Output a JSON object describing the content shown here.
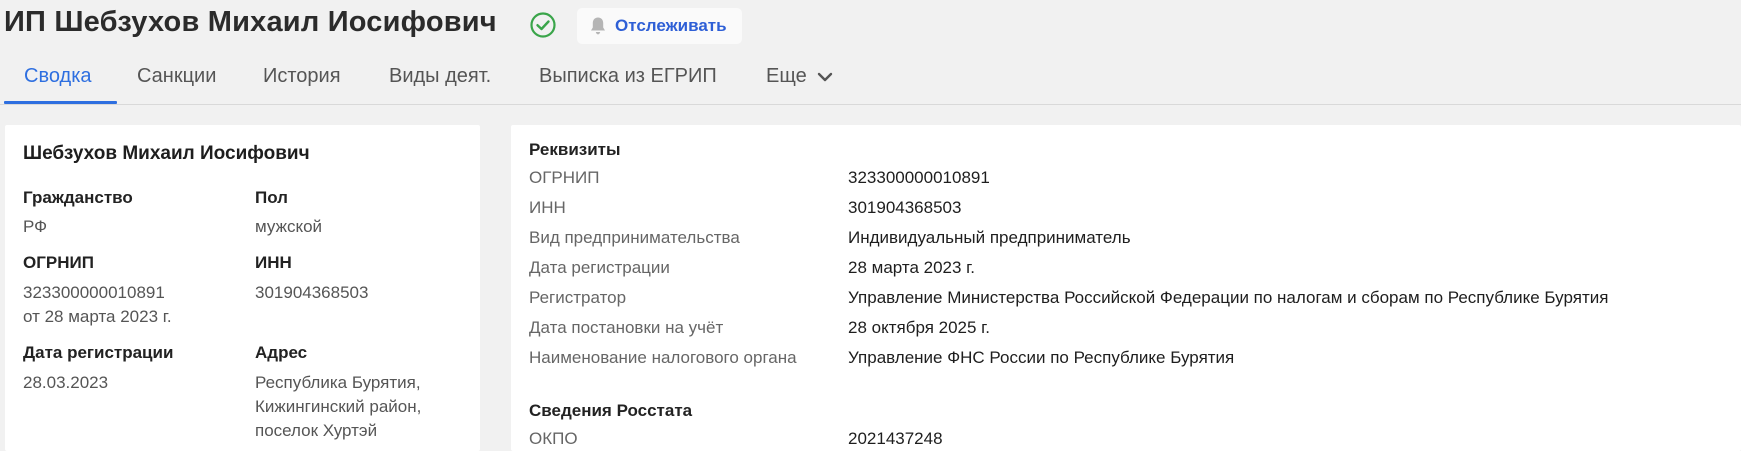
{
  "header": {
    "title": "ИП Шебзухов Михаил Иосифович",
    "verified_icon": "check-circle-icon",
    "track_label": "Отслеживать",
    "track_icon": "bell-icon",
    "accent_color": "#2e6fe0",
    "verified_color": "#3aa54a"
  },
  "tabs": [
    {
      "label": "Сводка",
      "active": true
    },
    {
      "label": "Санкции"
    },
    {
      "label": "История"
    },
    {
      "label": "Виды деят."
    },
    {
      "label": "Выписка из ЕГРИП"
    },
    {
      "label": "Еще"
    }
  ],
  "summary": {
    "name": "Шебзухов Михаил Иосифович",
    "citizenship_label": "Гражданство",
    "citizenship_value": "РФ",
    "gender_label": "Пол",
    "gender_value": "мужской",
    "ogrnip_label": "ОГРНИП",
    "ogrnip_value": "323300000010891",
    "ogrnip_date": "от 28 марта 2023 г.",
    "inn_label": "ИНН",
    "inn_value": "301904368503",
    "regdate_label": "Дата регистрации",
    "regdate_value": "28.03.2023",
    "address_label": "Адрес",
    "address_line1": "Республика Бурятия,",
    "address_line2": "Кижингинский район,",
    "address_line3": "поселок Хуртэй"
  },
  "requisites": {
    "title": "Реквизиты",
    "rows": [
      {
        "label": "ОГРНИП",
        "value": "323300000010891"
      },
      {
        "label": "ИНН",
        "value": "301904368503"
      },
      {
        "label": "Вид предпринимательства",
        "value": "Индивидуальный предприниматель"
      },
      {
        "label": "Дата регистрации",
        "value": "28 марта 2023 г."
      },
      {
        "label": "Регистратор",
        "value": "Управление Министерства Российской Федерации по налогам и сборам по Республике Бурятия"
      },
      {
        "label": "Дата постановки на учёт",
        "value": "28 октября 2025 г."
      },
      {
        "label": "Наименование налогового органа",
        "value": "Управление ФНС России по Республике Бурятия"
      }
    ]
  },
  "rosstat": {
    "title": "Сведения Росстата",
    "rows": [
      {
        "label": "ОКПО",
        "value": "2021437248"
      }
    ]
  }
}
